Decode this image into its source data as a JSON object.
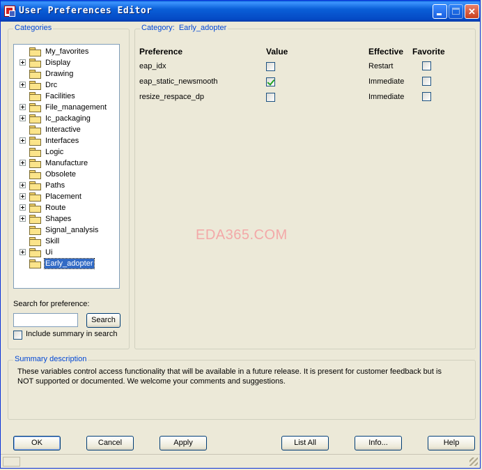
{
  "window": {
    "title": "User Preferences Editor",
    "colors": {
      "titlebar": "#0a5fd8",
      "accent": "#0046d5",
      "selection": "#316ac5"
    }
  },
  "categories": {
    "legend": "Categories",
    "items": [
      {
        "label": "My_favorites",
        "expandable": false
      },
      {
        "label": "Display",
        "expandable": true
      },
      {
        "label": "Drawing",
        "expandable": false
      },
      {
        "label": "Drc",
        "expandable": true
      },
      {
        "label": "Facilities",
        "expandable": false
      },
      {
        "label": "File_management",
        "expandable": true
      },
      {
        "label": "Ic_packaging",
        "expandable": true
      },
      {
        "label": "Interactive",
        "expandable": false
      },
      {
        "label": "Interfaces",
        "expandable": true
      },
      {
        "label": "Logic",
        "expandable": false
      },
      {
        "label": "Manufacture",
        "expandable": true
      },
      {
        "label": "Obsolete",
        "expandable": false
      },
      {
        "label": "Paths",
        "expandable": true
      },
      {
        "label": "Placement",
        "expandable": true
      },
      {
        "label": "Route",
        "expandable": true
      },
      {
        "label": "Shapes",
        "expandable": true
      },
      {
        "label": "Signal_analysis",
        "expandable": false
      },
      {
        "label": "Skill",
        "expandable": false
      },
      {
        "label": "Ui",
        "expandable": true
      },
      {
        "label": "Early_adopter",
        "expandable": false,
        "selected": true
      }
    ]
  },
  "search": {
    "label": "Search for preference:",
    "value": "",
    "button": "Search",
    "include_summary_label": "Include summary in search",
    "include_summary_checked": false
  },
  "category_panel": {
    "legend_prefix": "Category:",
    "legend_value": "Early_adopter",
    "headers": {
      "preference": "Preference",
      "value": "Value",
      "effective": "Effective",
      "favorite": "Favorite"
    },
    "rows": [
      {
        "name": "eap_idx",
        "value_checked": false,
        "effective": "Restart",
        "favorite": false
      },
      {
        "name": "eap_static_newsmooth",
        "value_checked": true,
        "effective": "Immediate",
        "favorite": false
      },
      {
        "name": "resize_respace_dp",
        "value_checked": false,
        "effective": "Immediate",
        "favorite": false
      }
    ],
    "watermark": "EDA365.COM"
  },
  "summary": {
    "legend": "Summary description",
    "text": "These variables control access functionality that will be available in a future release. It is present for customer feedback but is NOT supported or documented. We welcome your comments and suggestions."
  },
  "buttons": {
    "ok": "OK",
    "cancel": "Cancel",
    "apply": "Apply",
    "list_all": "List All",
    "info": "Info...",
    "help": "Help"
  }
}
